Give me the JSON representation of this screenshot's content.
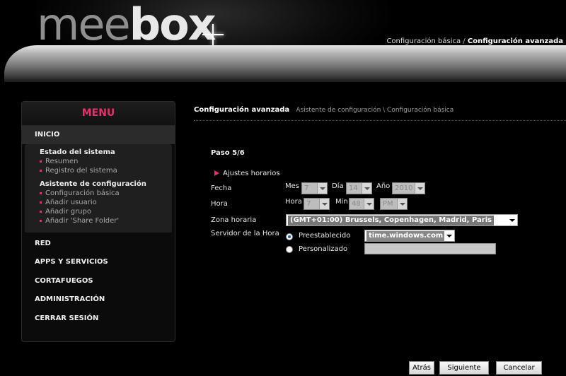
{
  "logo": {
    "part1": "mee",
    "part2": "box"
  },
  "topnav": {
    "basic": "Configuración básica",
    "separator": "/",
    "advanced": "Configuración avanzada"
  },
  "menu": {
    "title": "MENU",
    "home": "INICIO",
    "groups": [
      {
        "title": "Estado del sistema",
        "items": [
          "Resumen",
          "Registro del sistema"
        ]
      },
      {
        "title": "Asistente de configuración",
        "items": [
          "Configuración básica",
          "Añadir usuario",
          "Añadir grupo",
          "Añadir 'Share Folder'"
        ]
      }
    ],
    "sections": [
      "RED",
      "APPS Y SERVICIOS",
      "CORTAFUEGOS",
      "ADMINISTRACIÓN",
      "CERRAR SESIÓN"
    ]
  },
  "breadcrumb": {
    "current": "Configuración avanzada",
    "trail": "Asistente de configuración \\ Configuración básica"
  },
  "wizard": {
    "step": "Paso 5/6",
    "section": "Ajustes horarios",
    "fecha": {
      "label": "Fecha",
      "mes_label": "Mes",
      "mes": "7",
      "dia_label": "Día",
      "dia": "14",
      "anio_label": "Año",
      "anio": "2010"
    },
    "hora": {
      "label": "Hora",
      "hora_label": "Hora",
      "hora": "7",
      "min_label": "Min",
      "min": "48",
      "ampm": "PM"
    },
    "zona": {
      "label": "Zona horaria",
      "value": "(GMT+01:00) Brussels, Copenhagen, Madrid, Paris"
    },
    "servidor": {
      "label": "Servidor de la Hora",
      "preset_label": "Preestablecido",
      "preset_value": "time.windows.com",
      "custom_label": "Personalizado",
      "custom_value": ""
    }
  },
  "buttons": {
    "back": "Atrás",
    "next": "Siguiente",
    "cancel": "Cancelar"
  },
  "colors": {
    "accent": "#e8306c",
    "background": "#000000"
  }
}
